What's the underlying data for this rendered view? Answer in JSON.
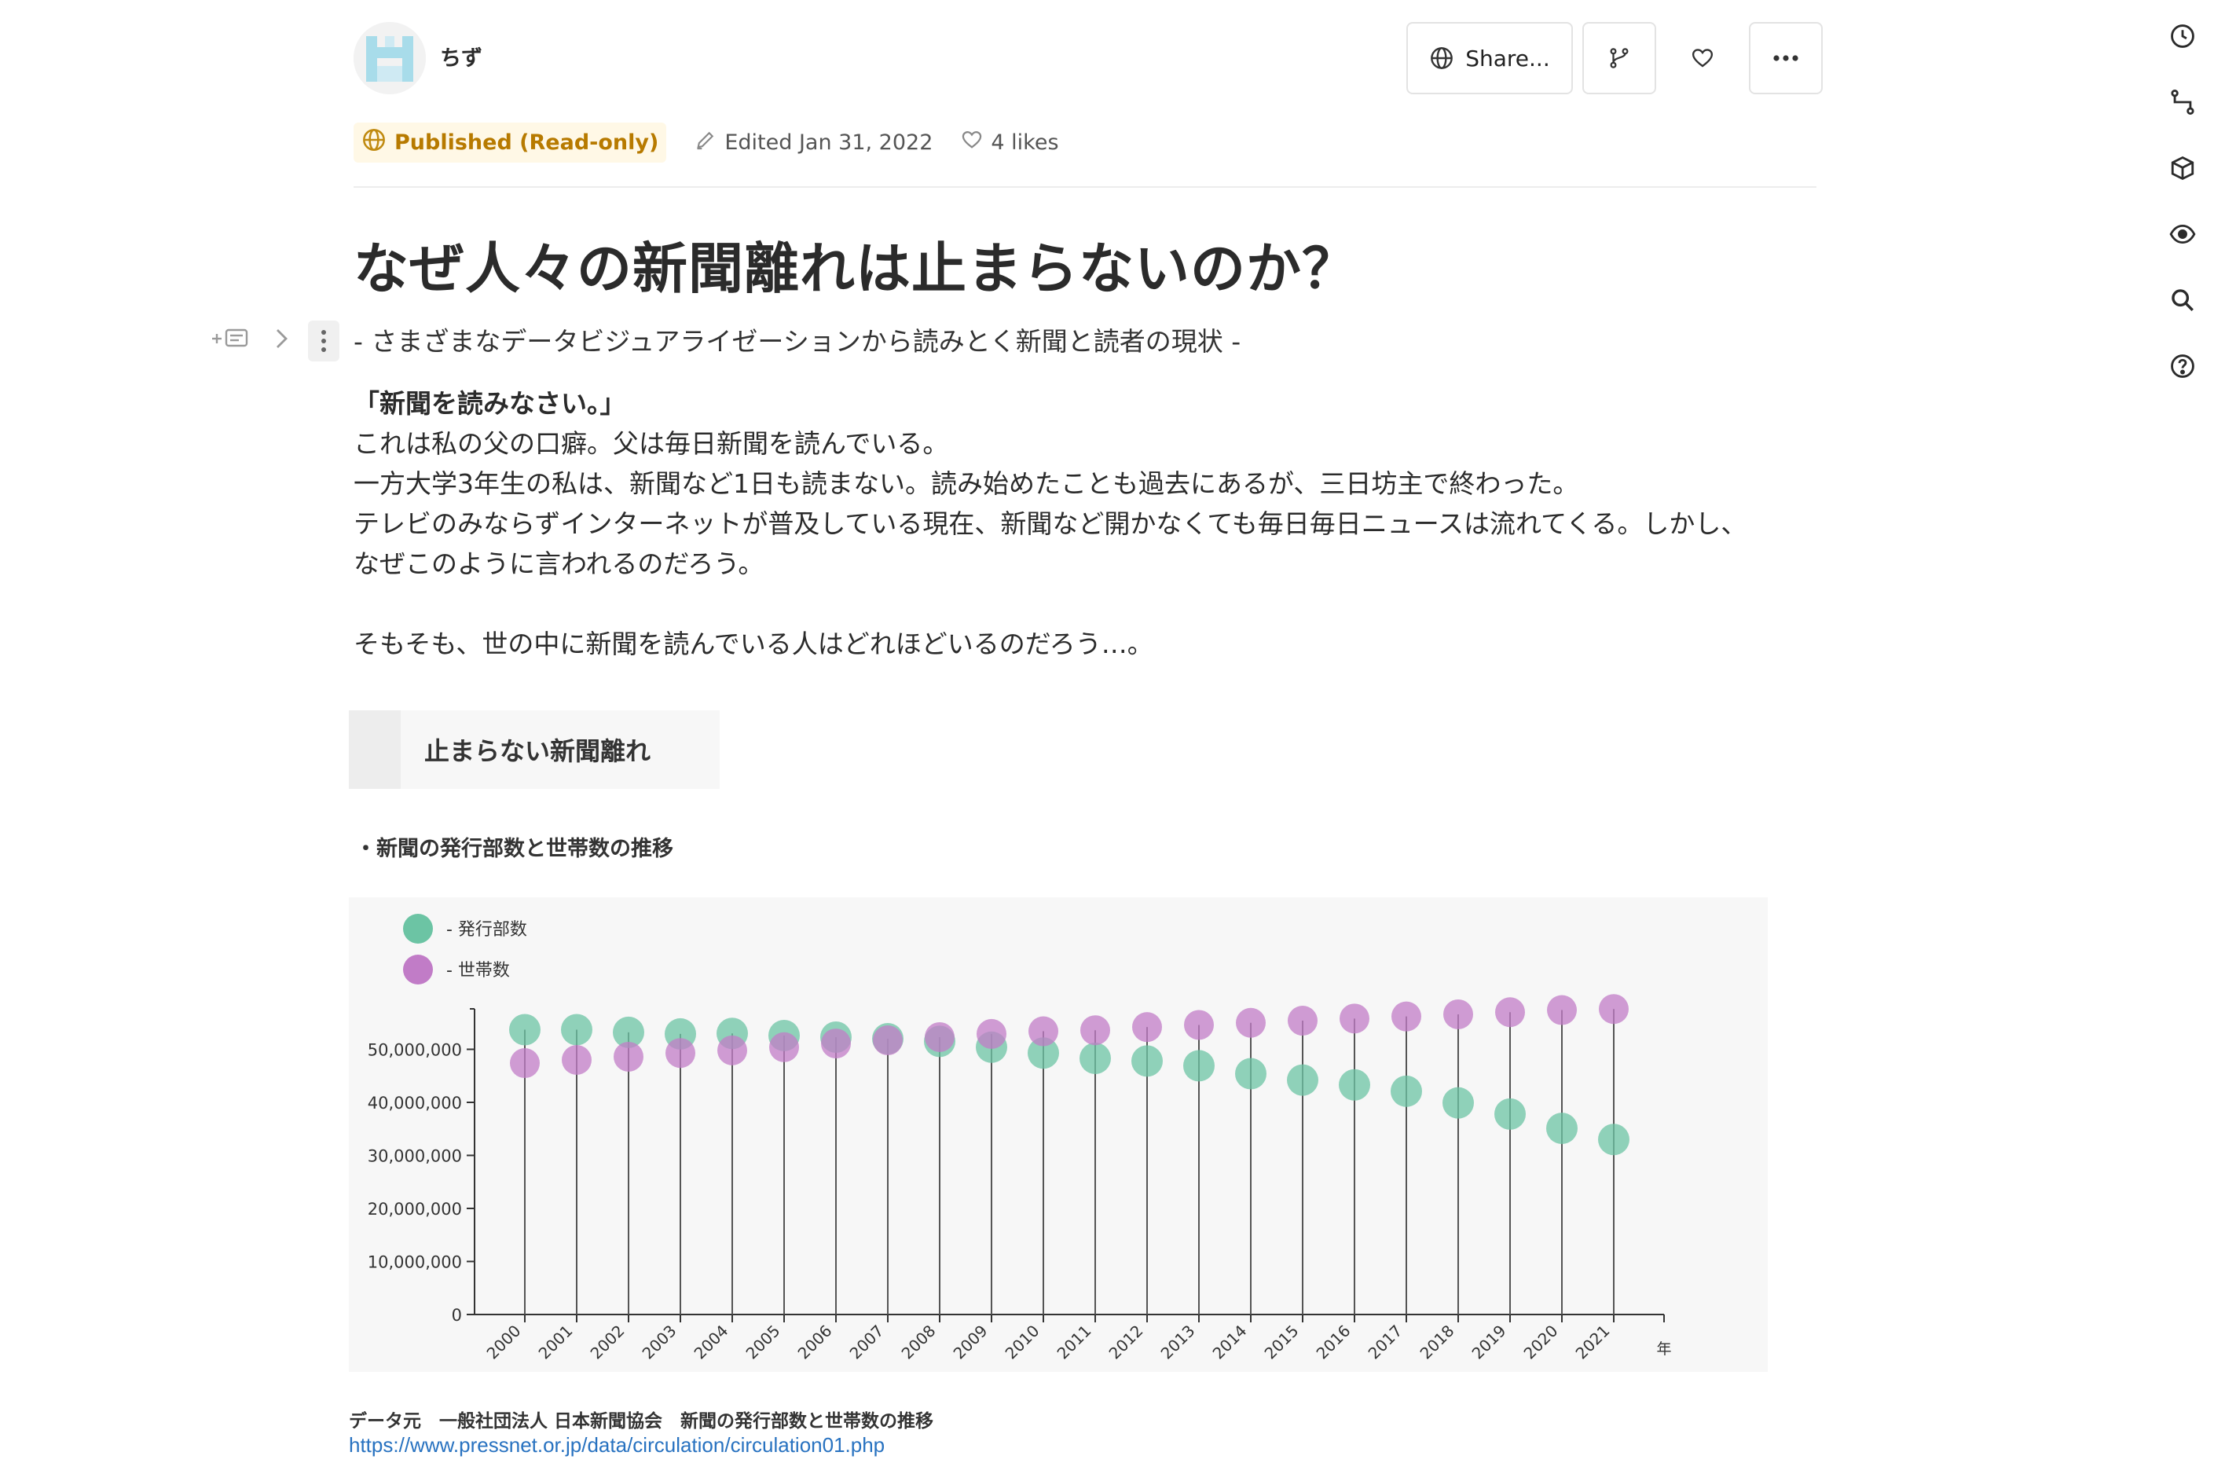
{
  "header": {
    "username": "ちず",
    "share_label": "Share...",
    "icons": {
      "branch": "branch-icon",
      "like": "heart-icon",
      "more": "more-icon",
      "globe": "globe-icon"
    }
  },
  "rail": {
    "icons": [
      "clock-icon",
      "graph-icon",
      "cube-icon",
      "eye-icon",
      "search-icon",
      "help-icon"
    ]
  },
  "meta": {
    "status": "Published (Read-only)",
    "edited": "Edited Jan 31, 2022",
    "likes": "4 likes"
  },
  "article": {
    "title": "なぜ人々の新聞離れは止まらないのか？",
    "subtitle": "- さまざまなデータビジュアライゼーションから読みとく新聞と読者の現状 -",
    "quote": "「新聞を読みなさい。」",
    "lines": [
      "これは私の父の口癖。父は毎日新聞を読んでいる。",
      "一方大学3年生の私は、新聞など1日も読まない。読み始めたことも過去にあるが、三日坊主で終わった。",
      "テレビのみならずインターネットが普及している現在、新聞など開かなくても毎日毎日ニュースは流れてくる。しかし、",
      "なぜこのように言われるのだろう。"
    ],
    "question": "そもそも、世の中に新聞を読んでいる人はどれほどいるのだろう…。",
    "section_heading": "止まらない新聞離れ",
    "chart_caption": "・新聞の発行部数と世帯数の推移",
    "source_label": "データ元　一般社団法人 日本新聞協会　新聞の発行部数と世帯数の推移",
    "source_url": "https://www.pressnet.or.jp/data/circulation/circulation01.php"
  },
  "chart_data": {
    "type": "scatter",
    "title": "",
    "xlabel": "年",
    "ylabel": "",
    "ylim": [
      0,
      55000000
    ],
    "yticks": [
      "0",
      "10,000,000",
      "20,000,000",
      "30,000,000",
      "40,000,000",
      "50,000,000"
    ],
    "ytick_values": [
      0,
      10000000,
      20000000,
      30000000,
      40000000,
      50000000
    ],
    "legend_position": "top-left",
    "grid": false,
    "categories": [
      "2000",
      "2001",
      "2002",
      "2003",
      "2004",
      "2005",
      "2006",
      "2007",
      "2008",
      "2009",
      "2010",
      "2011",
      "2012",
      "2013",
      "2014",
      "2015",
      "2016",
      "2017",
      "2018",
      "2019",
      "2020",
      "2021"
    ],
    "series": [
      {
        "name": "- 発行部数",
        "color": "#6cc4a4",
        "values": [
          53700000,
          53700000,
          53200000,
          52900000,
          53000000,
          52600000,
          52300000,
          52000000,
          51500000,
          50400000,
          49300000,
          48300000,
          47800000,
          46900000,
          45400000,
          44200000,
          43300000,
          42100000,
          39900000,
          37800000,
          35100000,
          33000000
        ]
      },
      {
        "name": "- 世帯数",
        "color": "#c17cc7",
        "values": [
          47400000,
          48000000,
          48600000,
          49300000,
          49800000,
          50400000,
          51100000,
          51700000,
          52300000,
          52900000,
          53400000,
          53600000,
          54200000,
          54600000,
          55000000,
          55400000,
          55800000,
          56200000,
          56600000,
          57000000,
          57400000,
          57600000
        ]
      }
    ]
  }
}
